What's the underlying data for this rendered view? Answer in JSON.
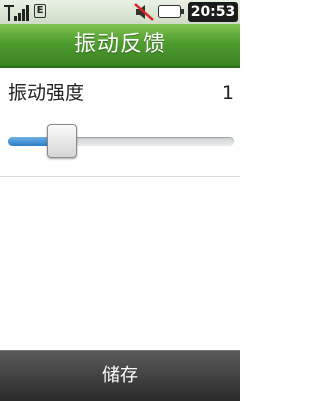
{
  "status_bar": {
    "network_badge": "E",
    "time": "20:53",
    "icons": [
      "signal-icon",
      "network-e-icon",
      "mute-icon",
      "battery-icon"
    ]
  },
  "header": {
    "title": "振动反馈"
  },
  "setting": {
    "label": "振动强度",
    "value": "1",
    "level_fraction": 0.2
  },
  "footer": {
    "save_label": "储存"
  },
  "colors": {
    "title_bar": "#4f9d2f",
    "slider_fill": "#2a7dc8",
    "bottom_bar": "#2b2b2b",
    "clock_bg": "#1b1b1b"
  }
}
